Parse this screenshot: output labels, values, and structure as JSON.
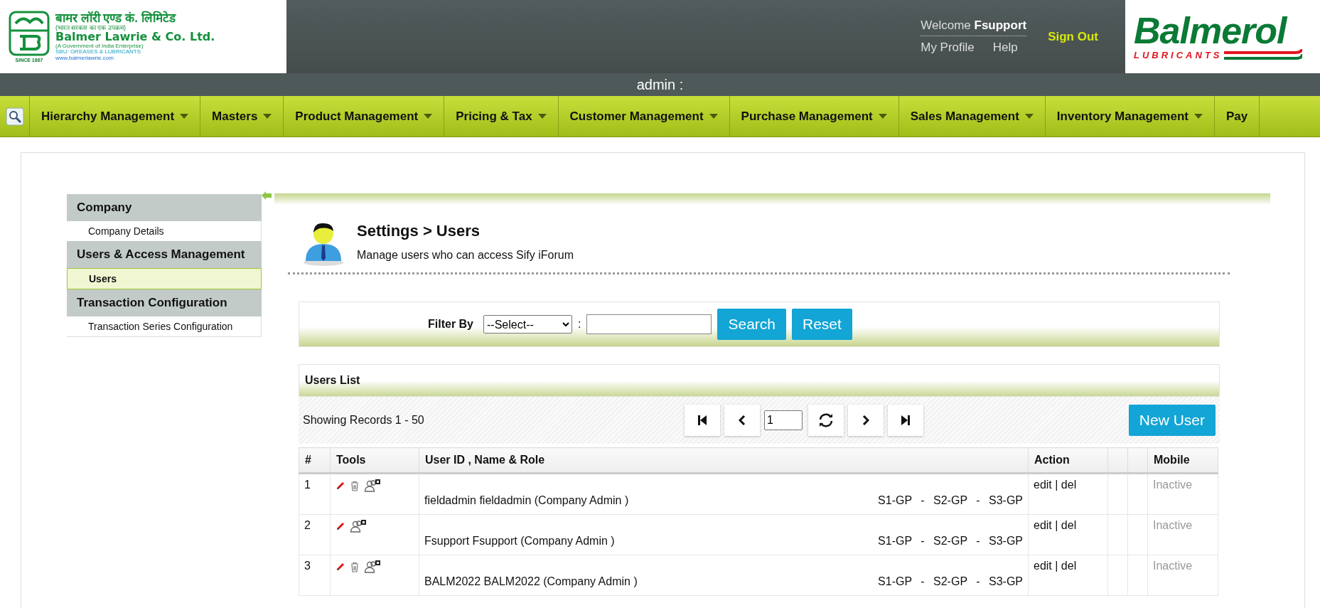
{
  "header": {
    "left_logo": {
      "hindi_name": "बामर लॉरी एण्ड कं. लिमिटेड",
      "hindi_tagline": "(भारत सरकार का एक उपक्रम)",
      "name": "Balmer Lawrie & Co. Ltd.",
      "tagline": "(A Government of India Enterprise)",
      "unit": "SBU: GREASES & LUBRICANTS",
      "website": "www.balmerlawrie.com",
      "since": "SINCE 1867"
    },
    "welcome": "Welcome",
    "user": "Fsupport",
    "links": [
      "My Profile",
      "Help"
    ],
    "sign_out": "Sign Out",
    "right_logo": {
      "brand": "Balmerol",
      "tagline": "LUBRICANTS"
    }
  },
  "role_bar": "admin :",
  "nav": [
    {
      "label": "Hierarchy Management",
      "caret": true
    },
    {
      "label": "Masters",
      "caret": true
    },
    {
      "label": "Product Management",
      "caret": true
    },
    {
      "label": "Pricing & Tax",
      "caret": true
    },
    {
      "label": "Customer Management",
      "caret": true
    },
    {
      "label": "Purchase Management",
      "caret": true
    },
    {
      "label": "Sales Management",
      "caret": true
    },
    {
      "label": "Inventory Management",
      "caret": true
    },
    {
      "label": "Pay",
      "caret": false
    }
  ],
  "sidebar": [
    {
      "title": "Company",
      "items": [
        {
          "label": "Company Details",
          "selected": false
        }
      ]
    },
    {
      "title": "Users & Access Management",
      "items": [
        {
          "label": "Users",
          "selected": true
        }
      ]
    },
    {
      "title": "Transaction Configuration",
      "items": [
        {
          "label": "Transaction Series Configuration",
          "selected": false
        }
      ]
    }
  ],
  "page": {
    "title": "Settings > Users",
    "subtitle": "Manage users who can access Sify iForum"
  },
  "filter": {
    "label": "Filter By",
    "select": "--Select--",
    "separator": ":",
    "buttons": [
      "Search",
      "Reset"
    ]
  },
  "list": {
    "title": "Users List",
    "showing": "Showing Records 1 - 50",
    "page": "1",
    "new_button": "New User"
  },
  "table": {
    "columns": [
      {
        "kind": "text",
        "label": "#"
      },
      {
        "kind": "text",
        "label": "Tools"
      },
      {
        "kind": "text",
        "label": "User ID , Name & Role"
      },
      {
        "kind": "text",
        "label": "Action"
      },
      {
        "kind": "blank"
      },
      {
        "kind": "blank"
      },
      {
        "kind": "text",
        "label": "Mobile"
      }
    ],
    "rows": [
      {
        "number": "1",
        "tools": [
          {
            "kind": "edit"
          },
          {
            "kind": "delete"
          },
          {
            "kind": "users"
          }
        ],
        "user": "fieldadmin fieldadmin (Company Admin )",
        "groups": "S1-GP - S2-GP - S3-GP",
        "edit": "edit",
        "separator": "|",
        "delete": "del",
        "mobile": "Inactive"
      },
      {
        "number": "2",
        "tools": [
          {
            "kind": "edit"
          },
          {
            "kind": "users"
          }
        ],
        "user": "Fsupport Fsupport (Company Admin )",
        "groups": "S1-GP - S2-GP - S3-GP",
        "edit": "edit",
        "separator": "|",
        "delete": "del",
        "mobile": "Inactive"
      },
      {
        "number": "3",
        "tools": [
          {
            "kind": "edit"
          },
          {
            "kind": "delete"
          },
          {
            "kind": "users"
          }
        ],
        "user": "BALM2022 BALM2022 (Company Admin )",
        "groups": "S1-GP - S2-GP - S3-GP",
        "edit": "edit",
        "separator": "|",
        "delete": "del",
        "mobile": "Inactive"
      }
    ]
  }
}
